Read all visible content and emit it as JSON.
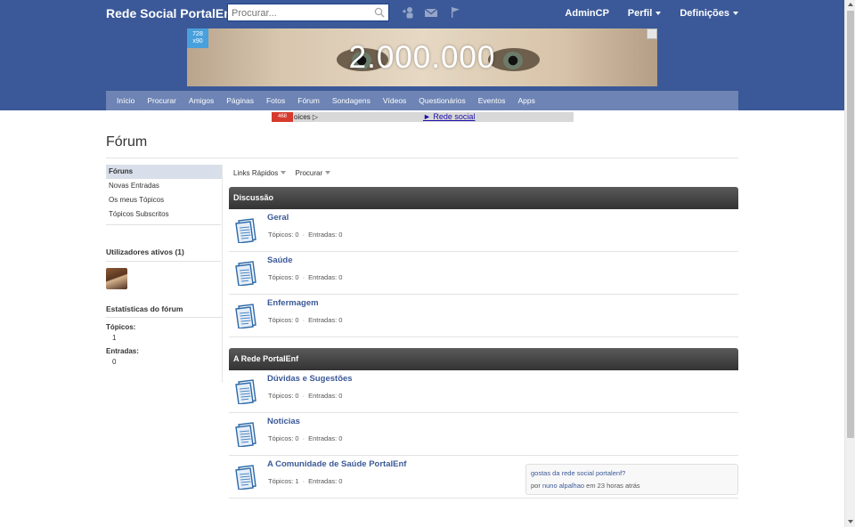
{
  "topbar": {
    "site_title": "Rede Social PortalEnf",
    "search_placeholder": "Procurar...",
    "admin_label": "AdminCP",
    "profile_label": "Perfil",
    "settings_label": "Definições"
  },
  "banner": {
    "headline": "2.000.000",
    "size_line1": "728",
    "size_line2": "x90"
  },
  "nav": {
    "items": [
      "Início",
      "Procurar",
      "Amigos",
      "Páginas",
      "Fotos",
      "Fórum",
      "Sondagens",
      "Vídeos",
      "Questionários",
      "Eventos",
      "Apps"
    ]
  },
  "adstrip": {
    "badge": "468",
    "choices_text": "oices ▷",
    "link_text": "► Rede social"
  },
  "page": {
    "title": "Fórum"
  },
  "sidebar": {
    "menu": [
      {
        "label": "Fóruns",
        "active": true
      },
      {
        "label": "Novas Entradas",
        "active": false
      },
      {
        "label": "Os meus Tópicos",
        "active": false
      },
      {
        "label": "Tópicos Subscritos",
        "active": false
      }
    ],
    "active_users_heading": "Utilizadores ativos (1)",
    "stats_heading": "Estatísticas do fórum",
    "topics_label": "Tópicos:",
    "topics_value": "1",
    "posts_label": "Entradas:",
    "posts_value": "0"
  },
  "toolbar": {
    "quick_links": "Links Rápidos",
    "search": "Procurar"
  },
  "categories": [
    {
      "name": "Discussão",
      "forums": [
        {
          "name": "Geral",
          "topics": "Tópicos: 0",
          "posts": "Entradas: 0"
        },
        {
          "name": "Saúde",
          "topics": "Tópicos: 0",
          "posts": "Entradas: 0"
        },
        {
          "name": "Enfermagem",
          "topics": "Tópicos: 0",
          "posts": "Entradas: 0"
        }
      ]
    },
    {
      "name": "A Rede PortalEnf",
      "forums": [
        {
          "name": "Dúvidas e Sugestões",
          "topics": "Tópicos: 0",
          "posts": "Entradas: 0"
        },
        {
          "name": "Notícias",
          "topics": "Tópicos: 0",
          "posts": "Entradas: 0"
        },
        {
          "name": "A Comunidade de Saúde PortalEnf",
          "topics": "Tópicos: 1",
          "posts": "Entradas: 0",
          "last_post": {
            "title": "gostas da rede social portalenf?",
            "by": "por",
            "user": "nuno alpalhao",
            "when": "em 23 horas atrás"
          }
        }
      ]
    }
  ],
  "colors": {
    "brand_blue": "#3b5998",
    "nav_blue": "#6d84b4",
    "sidebar_active": "#d8dfea",
    "category_header": "#3a3a3a"
  }
}
